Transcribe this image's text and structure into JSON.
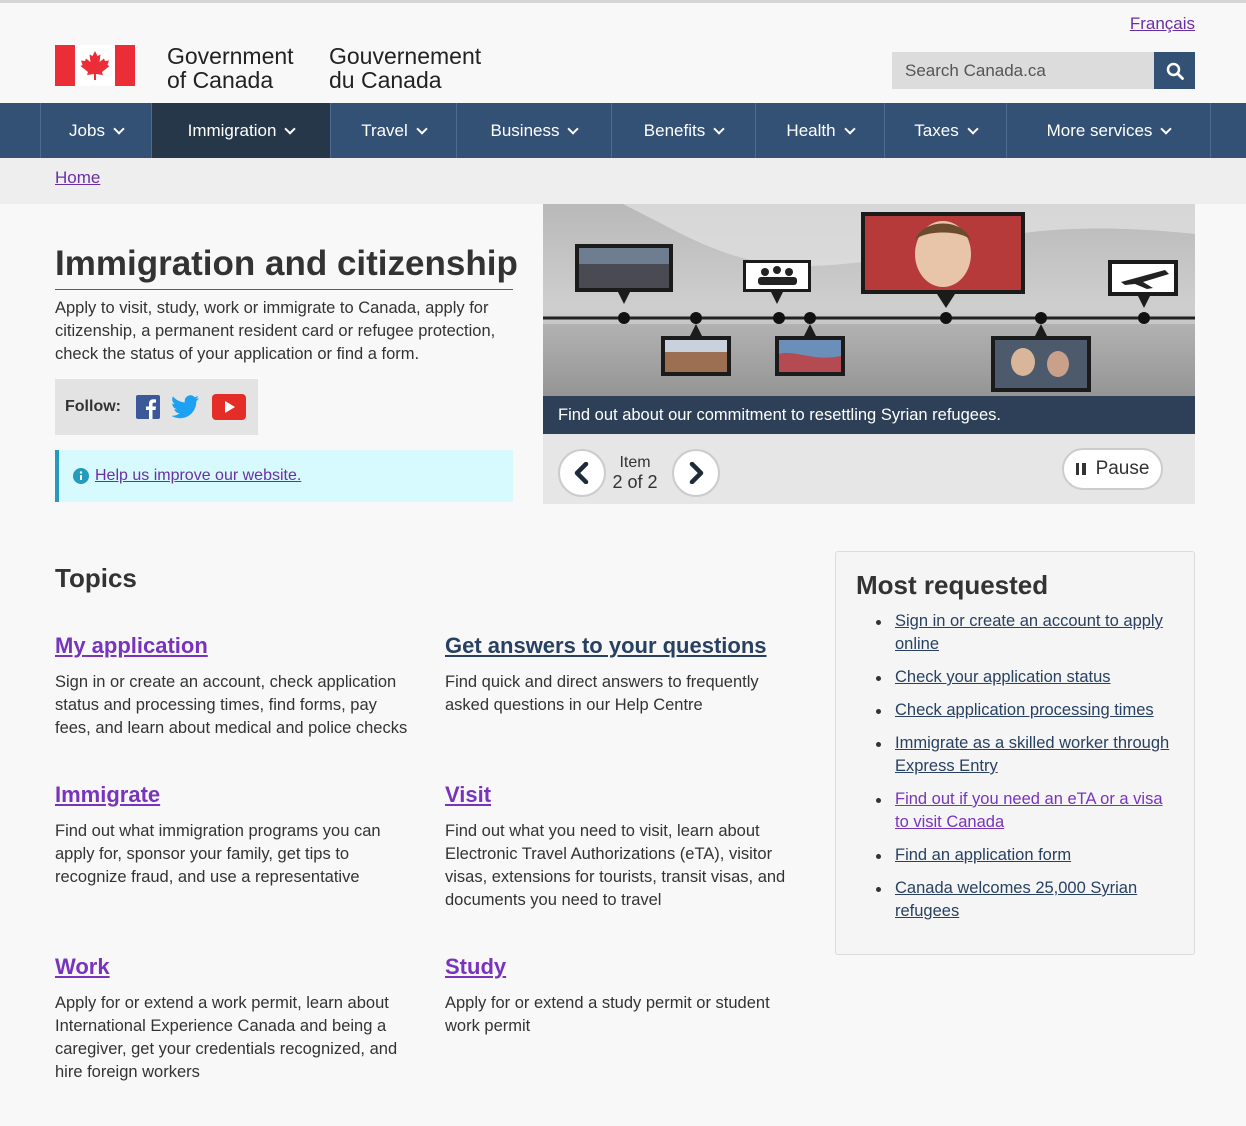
{
  "header": {
    "language_link": "Français",
    "signature_en_line1": "Government",
    "signature_en_line2": "of Canada",
    "signature_fr_line1": "Gouvernement",
    "signature_fr_line2": "du Canada",
    "search_placeholder": "Search Canada.ca",
    "brand_color": "#335075",
    "accent_red": "#eb2d37"
  },
  "nav": {
    "items": [
      {
        "label": "Jobs"
      },
      {
        "label": "Immigration"
      },
      {
        "label": "Travel"
      },
      {
        "label": "Business"
      },
      {
        "label": "Benefits"
      },
      {
        "label": "Health"
      },
      {
        "label": "Taxes"
      },
      {
        "label": "More services"
      }
    ]
  },
  "breadcrumb": {
    "home": "Home"
  },
  "intro": {
    "title": "Immigration and citizenship",
    "description": "Apply to visit, study, work or immigrate to Canada, apply for citizenship, a permanent resident card or refugee protection, check the status of your application or find a form.",
    "follow_label": "Follow:",
    "social_icons": [
      "facebook-icon",
      "twitter-icon",
      "youtube-icon"
    ],
    "improve_link": "Help us improve our website."
  },
  "carousel": {
    "caption": "Find out about our commitment to resettling Syrian refugees.",
    "item_label": "Item",
    "item_count": "2 of 2",
    "pause_label": "Pause"
  },
  "topics": {
    "heading": "Topics",
    "items": [
      {
        "title": "My application",
        "description": "Sign in or create an account, check application status and processing times, find forms, pay fees, and learn about medical and police checks"
      },
      {
        "title": "Get answers to your questions",
        "description": "Find quick and direct answers to frequently asked questions in our Help Centre"
      },
      {
        "title": "Immigrate",
        "description": "Find out what immigration programs you can apply for, sponsor your family, get tips to recognize fraud, and use a representative"
      },
      {
        "title": "Visit",
        "description": "Find out what you need to visit, learn about Electronic Travel Authorizations (eTA), visitor visas, extensions for tourists, transit visas, and documents you need to travel"
      },
      {
        "title": "Work",
        "description": "Apply for or extend a work permit, learn about International Experience Canada and being a caregiver, get your credentials recognized, and hire foreign workers"
      },
      {
        "title": "Study",
        "description": "Apply for or extend a study permit or student work permit"
      }
    ]
  },
  "most_requested": {
    "heading": "Most requested",
    "links": [
      {
        "label": "Sign in or create an account to apply online"
      },
      {
        "label": "Check your application status"
      },
      {
        "label": "Check application processing times"
      },
      {
        "label": "Immigrate as a skilled worker through Express Entry"
      },
      {
        "label": "Find out if you need an eTA or a visa to visit Canada"
      },
      {
        "label": "Find an application form"
      },
      {
        "label": "Canada welcomes 25,000 Syrian refugees"
      }
    ]
  }
}
